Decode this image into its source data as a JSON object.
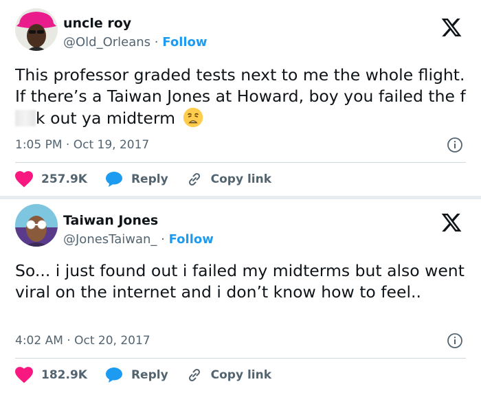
{
  "tweets": [
    {
      "author_name": "uncle roy",
      "handle": "@Old_Orleans",
      "separator": "·",
      "follow_label": "Follow",
      "text_part1": "This professor graded tests next to me the whole flight. If there’s a Taiwan Jones at Howard, boy you failed the f",
      "text_part2": "k out ya midterm",
      "time": "1:05 PM",
      "date": "Oct 19, 2017",
      "likes": "257.9K",
      "reply_label": "Reply",
      "copy_label": "Copy link"
    },
    {
      "author_name": "Taiwan Jones",
      "handle": "@JonesTaiwan_",
      "separator": "·",
      "follow_label": "Follow",
      "text": "So... i just found out i failed my midterms but also went viral on the internet and i don’t know how to feel..",
      "time": "4:02 AM",
      "date": "Oct 20, 2017",
      "likes": "182.9K",
      "reply_label": "Reply",
      "copy_label": "Copy link"
    }
  ],
  "icons": {
    "like": "heart-icon",
    "reply": "speech-bubble-icon",
    "copy": "link-icon",
    "info": "info-icon",
    "logo": "x-logo-icon",
    "emoji": "weary-face-emoji"
  },
  "colors": {
    "accent": "#1d9bf0",
    "like": "#f91880",
    "muted": "#536471",
    "text": "#0f1419",
    "separator": "#e6ecf0"
  }
}
